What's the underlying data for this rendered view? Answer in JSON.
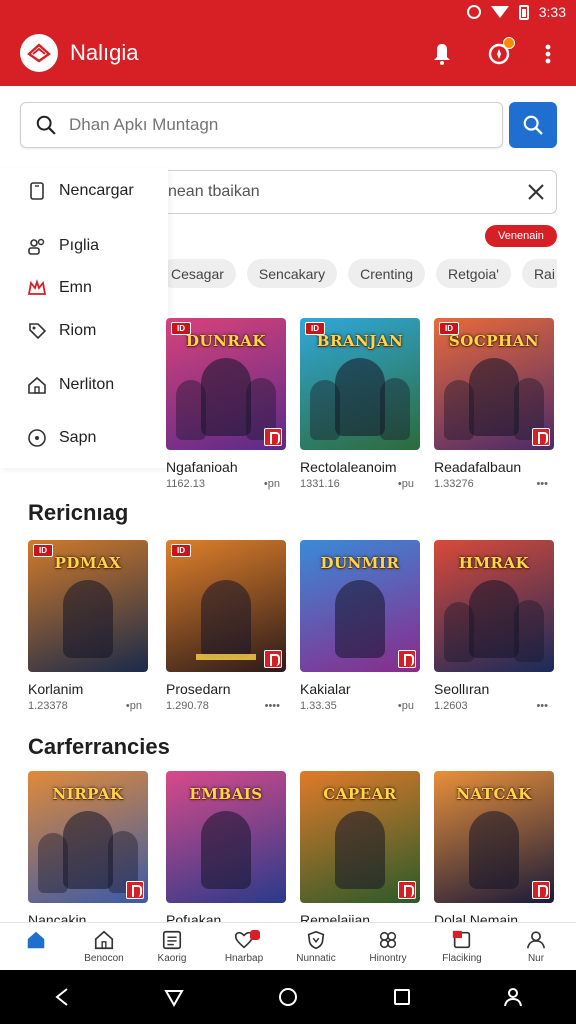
{
  "status_bar": {
    "time": "3:33"
  },
  "header": {
    "title": "Nalıgia"
  },
  "search": {
    "placeholder": "Dhan Apkı Muntagn"
  },
  "drawer": {
    "items": [
      {
        "label": "Nencargar",
        "icon": "phone-icon"
      },
      {
        "label": "Pıglia",
        "icon": "people-icon"
      },
      {
        "label": "Emn",
        "icon": "crown-icon"
      },
      {
        "label": "Riom",
        "icon": "tag-icon"
      },
      {
        "label": "Nerliton",
        "icon": "home-icon"
      },
      {
        "label": "Sapn",
        "icon": "circle-icon"
      }
    ]
  },
  "sub_search": {
    "value": "nean tbaikan"
  },
  "red_pill": "Venenain",
  "chips": [
    "Cesagar",
    "Sencakary",
    "Crenting",
    "Retgoia'",
    "Rai"
  ],
  "row1": [
    {
      "name": "Ngafanioah",
      "meta": "1162.13",
      "meta2": "•pn",
      "art": "DUNRAK",
      "colors": [
        "#d8427a",
        "#5a2a8a"
      ]
    },
    {
      "name": "Rectolaleanoim",
      "meta": "1331.16",
      "meta2": "•pu",
      "art": "BRANJAN",
      "colors": [
        "#2fa8d8",
        "#2e6a3a"
      ]
    },
    {
      "name": "Readafalbaun",
      "meta": "1.33276",
      "meta2": "•••",
      "art": "SOCPHAN",
      "colors": [
        "#e86a3a",
        "#4a2a6a"
      ]
    }
  ],
  "section2": {
    "title": "Rericnıag",
    "cards": [
      {
        "name": "Korlanim",
        "meta": "1.23378",
        "meta2": "•pn",
        "art": "PDMAX",
        "colors": [
          "#d07a2a",
          "#1a2a4a"
        ]
      },
      {
        "name": "Prosedarn",
        "meta": "1.290.78",
        "meta2": "••••",
        "art": "",
        "colors": [
          "#e0802a",
          "#2a1a1a"
        ]
      },
      {
        "name": "Kakialar",
        "meta": "1.33.35",
        "meta2": "•pu",
        "art": "DUNMIR",
        "colors": [
          "#3a8ad8",
          "#8a2a8a"
        ]
      },
      {
        "name": "Seollıran",
        "meta": "1.2603",
        "meta2": "•••",
        "art": "HMRAK",
        "colors": [
          "#d84a3a",
          "#1a2a5a"
        ]
      }
    ]
  },
  "section3": {
    "title": "Carferrancies",
    "cards": [
      {
        "name": "Nancakin",
        "art": "NIRPAK",
        "colors": [
          "#e08a3a",
          "#3a5aa8"
        ]
      },
      {
        "name": "Pofıakan",
        "art": "EMBAIS",
        "colors": [
          "#d84a8a",
          "#2a3a8a"
        ]
      },
      {
        "name": "Remelaiian",
        "art": "CAPEAR",
        "colors": [
          "#e07a2a",
          "#2a5a2a"
        ]
      },
      {
        "name": "Dolal Nemain",
        "art": "NATCAK",
        "colors": [
          "#e8903a",
          "#1a1a3a"
        ]
      }
    ]
  },
  "bottom_nav": [
    {
      "label": "",
      "icon": "home-filled-icon"
    },
    {
      "label": "Benocon",
      "icon": "house-icon"
    },
    {
      "label": "Kaorig",
      "icon": "list-icon"
    },
    {
      "label": "Hnarbap",
      "icon": "heart-badge-icon"
    },
    {
      "label": "Nunnatic",
      "icon": "shield-icon"
    },
    {
      "label": "Hinontry",
      "icon": "clover-icon"
    },
    {
      "label": "Flaciking",
      "icon": "card-badge-icon"
    },
    {
      "label": "Nur",
      "icon": "person-icon"
    }
  ]
}
